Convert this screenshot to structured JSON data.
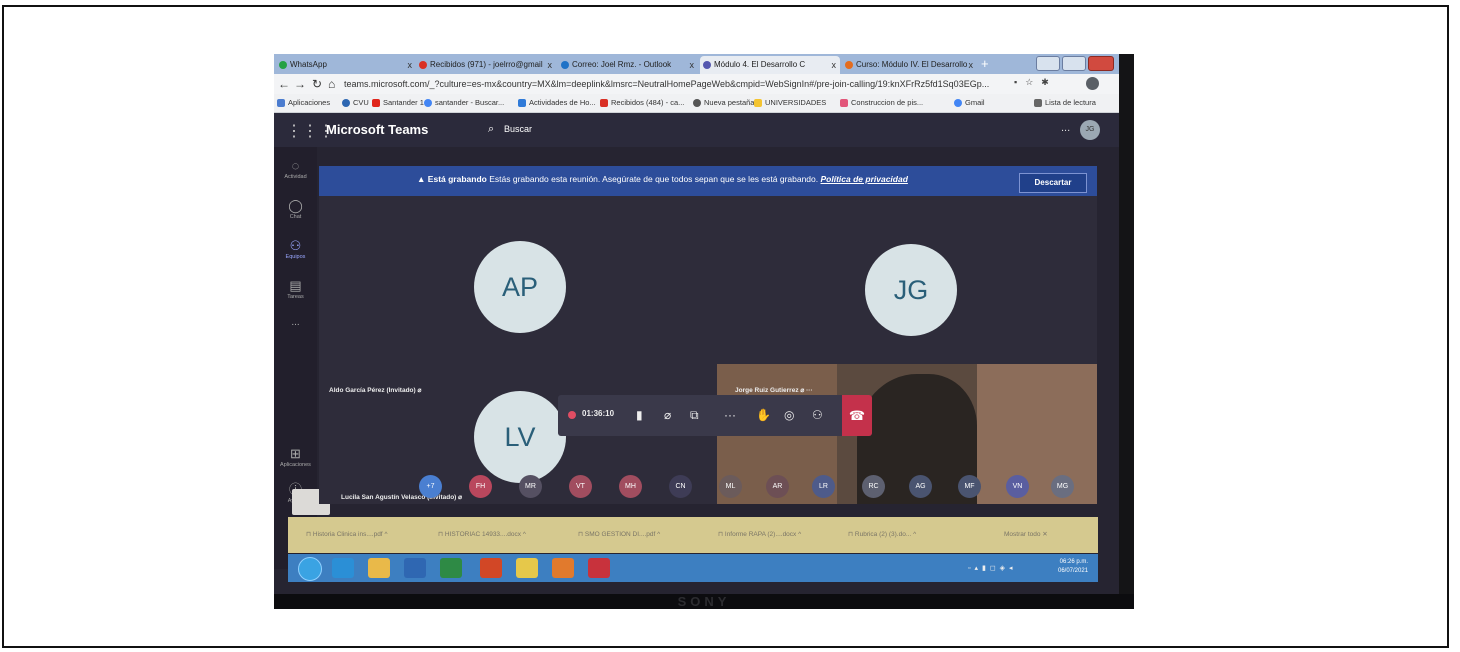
{
  "tabs": [
    {
      "label": "WhatsApp"
    },
    {
      "label": "Recibidos (971) - joelrro@gmail"
    },
    {
      "label": "Correo: Joel Rmz. - Outlook"
    },
    {
      "label": "Módulo 4. El Desarrollo C"
    },
    {
      "label": "Curso: Módulo IV. El Desarrollo"
    }
  ],
  "close_glyph": "x",
  "new_tab_glyph": "+",
  "address": {
    "url": "teams.microsoft.com/_?culture=es-mx&country=MX&lm=deeplink&lmsrc=NeutralHomePageWeb&cmpid=WebSignIn#/pre-join-calling/19:knXFrRz5fd1Sq03EGp..."
  },
  "bookmarks": [
    {
      "label": "Aplicaciones"
    },
    {
      "label": "CVU"
    },
    {
      "label": "Santander 1"
    },
    {
      "label": "santander - Buscar..."
    },
    {
      "label": "Actividades de Ho..."
    },
    {
      "label": "Recibidos (484) - ca..."
    },
    {
      "label": "Nueva pestaña"
    },
    {
      "label": "UNIVERSIDADES"
    },
    {
      "label": "Construccion de pis..."
    },
    {
      "label": "Gmail"
    },
    {
      "label": "Lista de lectura"
    }
  ],
  "teams": {
    "app_name": "Microsoft Teams",
    "search_label": "Buscar",
    "user_initials": "JG",
    "more": "...",
    "rail": [
      {
        "label": "Actividad"
      },
      {
        "label": "Chat"
      },
      {
        "label": "Equipos"
      },
      {
        "label": "Tareas"
      },
      {
        "label": "..."
      },
      {
        "label": "Aplicaciones"
      },
      {
        "label": "Ayuda"
      }
    ]
  },
  "banner": {
    "bold": "Está grabando",
    "text": "Estás grabando esta reunión. Asegúrate de que todos sepan que se les está grabando.",
    "link": "Política de privacidad",
    "dismiss": "Descartar"
  },
  "participants": [
    {
      "initials": "AP",
      "name": "Aldo García Pérez (Invitado)"
    },
    {
      "initials": "JG",
      "name": "Jorge Ruiz Gutierrez"
    },
    {
      "initials": "LV",
      "name": "Lucila San Agustín Velasco (Invitado)"
    }
  ],
  "call": {
    "timer": "01:36:10"
  },
  "mini_avatars": [
    {
      "initials": "+7",
      "color": "#4a7fd1"
    },
    {
      "initials": "FH",
      "color": "#b9475d"
    },
    {
      "initials": "MR",
      "color": "#555062"
    },
    {
      "initials": "VT",
      "color": "#a14d5f"
    },
    {
      "initials": "MH",
      "color": "#a14d5f"
    },
    {
      "initials": "CN",
      "color": "#3e3c56"
    },
    {
      "initials": "ML",
      "color": "#6b5b5b"
    },
    {
      "initials": "AR",
      "color": "#6d4f55"
    },
    {
      "initials": "LR",
      "color": "#4e5b8a"
    },
    {
      "initials": "RC",
      "color": "#5d6070"
    },
    {
      "initials": "AG",
      "color": "#4a5470"
    },
    {
      "initials": "MF",
      "color": "#4a5470"
    },
    {
      "initials": "VN",
      "color": "#5a5ea0"
    },
    {
      "initials": "MG",
      "color": "#6a6e80"
    }
  ],
  "downloads": [
    {
      "label": "Historia Clinica ins....pdf"
    },
    {
      "label": "HISTORIAC 14933....docx"
    },
    {
      "label": "SMO GESTION DI....pdf"
    },
    {
      "label": "Informe RAPA (2)....docx"
    },
    {
      "label": "Rubrica (2) (3).do..."
    }
  ],
  "download_caret": "^",
  "show_all": "Mostrar todo",
  "taskbar": {
    "time": "06:26 p.m.",
    "date": "06/07/2021"
  },
  "brand": "SONY"
}
